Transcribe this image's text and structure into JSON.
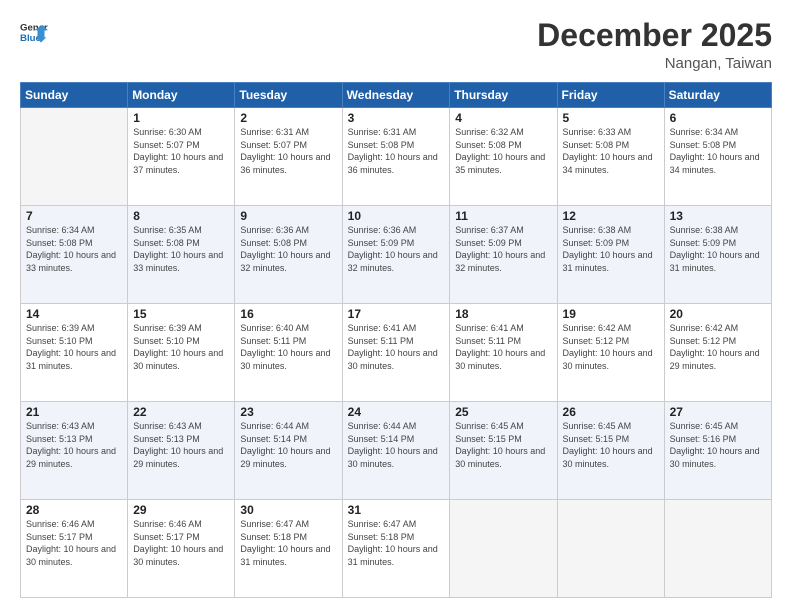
{
  "header": {
    "logo_line1": "General",
    "logo_line2": "Blue",
    "month_year": "December 2025",
    "location": "Nangan, Taiwan"
  },
  "weekdays": [
    "Sunday",
    "Monday",
    "Tuesday",
    "Wednesday",
    "Thursday",
    "Friday",
    "Saturday"
  ],
  "weeks": [
    [
      {
        "day": "",
        "sunrise": "",
        "sunset": "",
        "daylight": "",
        "empty": true
      },
      {
        "day": "1",
        "sunrise": "Sunrise: 6:30 AM",
        "sunset": "Sunset: 5:07 PM",
        "daylight": "Daylight: 10 hours and 37 minutes."
      },
      {
        "day": "2",
        "sunrise": "Sunrise: 6:31 AM",
        "sunset": "Sunset: 5:07 PM",
        "daylight": "Daylight: 10 hours and 36 minutes."
      },
      {
        "day": "3",
        "sunrise": "Sunrise: 6:31 AM",
        "sunset": "Sunset: 5:08 PM",
        "daylight": "Daylight: 10 hours and 36 minutes."
      },
      {
        "day": "4",
        "sunrise": "Sunrise: 6:32 AM",
        "sunset": "Sunset: 5:08 PM",
        "daylight": "Daylight: 10 hours and 35 minutes."
      },
      {
        "day": "5",
        "sunrise": "Sunrise: 6:33 AM",
        "sunset": "Sunset: 5:08 PM",
        "daylight": "Daylight: 10 hours and 34 minutes."
      },
      {
        "day": "6",
        "sunrise": "Sunrise: 6:34 AM",
        "sunset": "Sunset: 5:08 PM",
        "daylight": "Daylight: 10 hours and 34 minutes."
      }
    ],
    [
      {
        "day": "7",
        "sunrise": "Sunrise: 6:34 AM",
        "sunset": "Sunset: 5:08 PM",
        "daylight": "Daylight: 10 hours and 33 minutes."
      },
      {
        "day": "8",
        "sunrise": "Sunrise: 6:35 AM",
        "sunset": "Sunset: 5:08 PM",
        "daylight": "Daylight: 10 hours and 33 minutes."
      },
      {
        "day": "9",
        "sunrise": "Sunrise: 6:36 AM",
        "sunset": "Sunset: 5:08 PM",
        "daylight": "Daylight: 10 hours and 32 minutes."
      },
      {
        "day": "10",
        "sunrise": "Sunrise: 6:36 AM",
        "sunset": "Sunset: 5:09 PM",
        "daylight": "Daylight: 10 hours and 32 minutes."
      },
      {
        "day": "11",
        "sunrise": "Sunrise: 6:37 AM",
        "sunset": "Sunset: 5:09 PM",
        "daylight": "Daylight: 10 hours and 32 minutes."
      },
      {
        "day": "12",
        "sunrise": "Sunrise: 6:38 AM",
        "sunset": "Sunset: 5:09 PM",
        "daylight": "Daylight: 10 hours and 31 minutes."
      },
      {
        "day": "13",
        "sunrise": "Sunrise: 6:38 AM",
        "sunset": "Sunset: 5:09 PM",
        "daylight": "Daylight: 10 hours and 31 minutes."
      }
    ],
    [
      {
        "day": "14",
        "sunrise": "Sunrise: 6:39 AM",
        "sunset": "Sunset: 5:10 PM",
        "daylight": "Daylight: 10 hours and 31 minutes."
      },
      {
        "day": "15",
        "sunrise": "Sunrise: 6:39 AM",
        "sunset": "Sunset: 5:10 PM",
        "daylight": "Daylight: 10 hours and 30 minutes."
      },
      {
        "day": "16",
        "sunrise": "Sunrise: 6:40 AM",
        "sunset": "Sunset: 5:11 PM",
        "daylight": "Daylight: 10 hours and 30 minutes."
      },
      {
        "day": "17",
        "sunrise": "Sunrise: 6:41 AM",
        "sunset": "Sunset: 5:11 PM",
        "daylight": "Daylight: 10 hours and 30 minutes."
      },
      {
        "day": "18",
        "sunrise": "Sunrise: 6:41 AM",
        "sunset": "Sunset: 5:11 PM",
        "daylight": "Daylight: 10 hours and 30 minutes."
      },
      {
        "day": "19",
        "sunrise": "Sunrise: 6:42 AM",
        "sunset": "Sunset: 5:12 PM",
        "daylight": "Daylight: 10 hours and 30 minutes."
      },
      {
        "day": "20",
        "sunrise": "Sunrise: 6:42 AM",
        "sunset": "Sunset: 5:12 PM",
        "daylight": "Daylight: 10 hours and 29 minutes."
      }
    ],
    [
      {
        "day": "21",
        "sunrise": "Sunrise: 6:43 AM",
        "sunset": "Sunset: 5:13 PM",
        "daylight": "Daylight: 10 hours and 29 minutes."
      },
      {
        "day": "22",
        "sunrise": "Sunrise: 6:43 AM",
        "sunset": "Sunset: 5:13 PM",
        "daylight": "Daylight: 10 hours and 29 minutes."
      },
      {
        "day": "23",
        "sunrise": "Sunrise: 6:44 AM",
        "sunset": "Sunset: 5:14 PM",
        "daylight": "Daylight: 10 hours and 29 minutes."
      },
      {
        "day": "24",
        "sunrise": "Sunrise: 6:44 AM",
        "sunset": "Sunset: 5:14 PM",
        "daylight": "Daylight: 10 hours and 30 minutes."
      },
      {
        "day": "25",
        "sunrise": "Sunrise: 6:45 AM",
        "sunset": "Sunset: 5:15 PM",
        "daylight": "Daylight: 10 hours and 30 minutes."
      },
      {
        "day": "26",
        "sunrise": "Sunrise: 6:45 AM",
        "sunset": "Sunset: 5:15 PM",
        "daylight": "Daylight: 10 hours and 30 minutes."
      },
      {
        "day": "27",
        "sunrise": "Sunrise: 6:45 AM",
        "sunset": "Sunset: 5:16 PM",
        "daylight": "Daylight: 10 hours and 30 minutes."
      }
    ],
    [
      {
        "day": "28",
        "sunrise": "Sunrise: 6:46 AM",
        "sunset": "Sunset: 5:17 PM",
        "daylight": "Daylight: 10 hours and 30 minutes."
      },
      {
        "day": "29",
        "sunrise": "Sunrise: 6:46 AM",
        "sunset": "Sunset: 5:17 PM",
        "daylight": "Daylight: 10 hours and 30 minutes."
      },
      {
        "day": "30",
        "sunrise": "Sunrise: 6:47 AM",
        "sunset": "Sunset: 5:18 PM",
        "daylight": "Daylight: 10 hours and 31 minutes."
      },
      {
        "day": "31",
        "sunrise": "Sunrise: 6:47 AM",
        "sunset": "Sunset: 5:18 PM",
        "daylight": "Daylight: 10 hours and 31 minutes."
      },
      {
        "day": "",
        "sunrise": "",
        "sunset": "",
        "daylight": "",
        "empty": true
      },
      {
        "day": "",
        "sunrise": "",
        "sunset": "",
        "daylight": "",
        "empty": true
      },
      {
        "day": "",
        "sunrise": "",
        "sunset": "",
        "daylight": "",
        "empty": true
      }
    ]
  ]
}
